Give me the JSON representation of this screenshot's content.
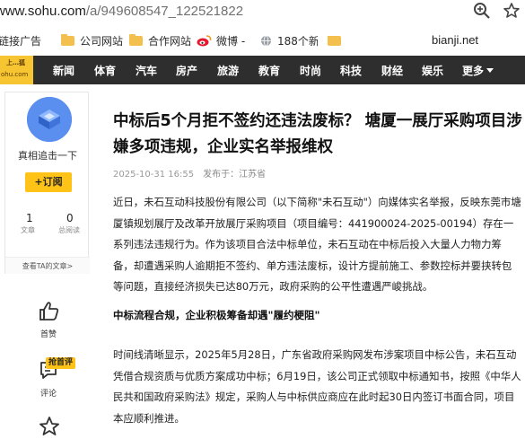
{
  "browser": {
    "url_host": "www.sohu.com",
    "url_path": "/a/949608547_122521822",
    "bookmarks": [
      {
        "label": "链接广告"
      },
      {
        "label": "公司网站"
      },
      {
        "label": "合作网站"
      },
      {
        "label": "微博 -"
      },
      {
        "label": "188个新"
      },
      {
        "label": ""
      }
    ],
    "bookmark_right": "bianji.net",
    "icons": {
      "zoom": "zoom-in-icon",
      "star": "bookmark-star-icon",
      "menu": "more-icon"
    }
  },
  "nav": {
    "logo_line1": "上…狐",
    "logo_line2": "ohu.com",
    "items": [
      "新闻",
      "体育",
      "汽车",
      "房产",
      "旅游",
      "教育",
      "时尚",
      "科技",
      "财经",
      "娱乐"
    ],
    "more": "更多"
  },
  "author": {
    "name": "真相追击一下",
    "follow": "+订阅",
    "articles_count": "1",
    "articles_label": "文章",
    "reads_count": "0",
    "reads_label": "总阅读",
    "link": "查看TA的文章>"
  },
  "actions": {
    "like_label": "首赞",
    "comment_badge": "抢首评",
    "comment_label": "评论"
  },
  "article": {
    "title": "中标后5个月拒不签约还违法废标？ 塘厦一展厅采购项目涉嫌多项违规，企业实名举报维权",
    "date": "2025-10-31 16:55",
    "source": "发布于：江苏省",
    "para1": "近日，未石互动科技股份有限公司（以下简称\"未石互动\"）向媒体实名举报，反映东莞市塘厦镇规划展厅及改革开放展厅采购项目（项目编号：441900024-2025-00194）存在一系列违法违规行为。作为该项目合法中标单位，未石互动在中标后投入大量人力物力筹备，却遭遇采购人逾期拒不签约、单方违法废标，设计方提前施工、参数控标并要挟转包等问题，直接经济损失已达80万元，政府采购的公平性遭遇严峻挑战。",
    "subhead": "中标流程合规，企业积极筹备却遇\"履约梗阻\"",
    "para2": "时间线清晰显示，2025年5月28日，广东省政府采购网发布涉案项目中标公告，未石互动凭借合规资质与优质方案成功中标；6月19日，该公司正式领取中标通知书，按照《中华人民共和国政府采购法》规定，采购人与中标供应商应在此时起30日内签订书面合同，项目本应顺利推进。"
  },
  "colors": {
    "nav_bg": "#2e2e2e",
    "accent": "#ffc318",
    "avatar": "#4f86e8"
  }
}
